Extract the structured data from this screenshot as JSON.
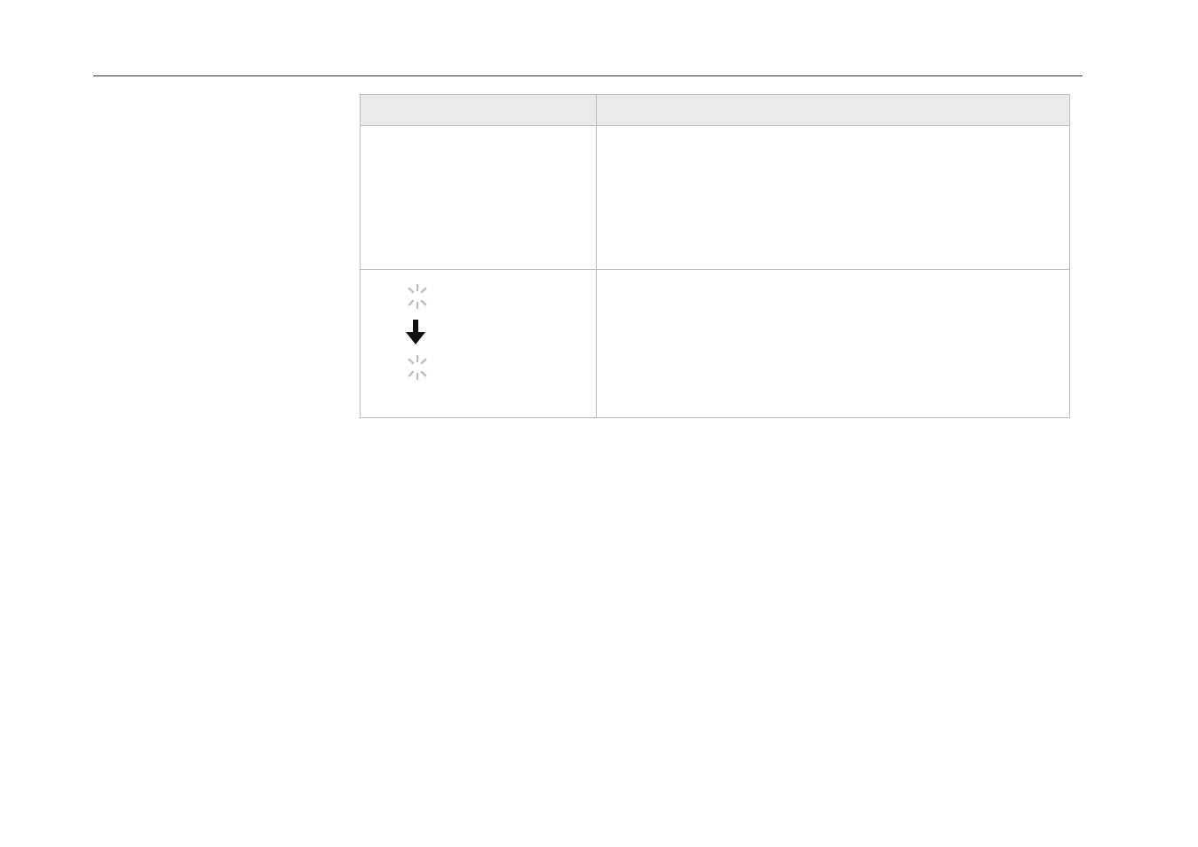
{
  "table": {
    "headers": [
      "",
      ""
    ],
    "rows": [
      {
        "col1": "",
        "col2": ""
      },
      {
        "col1": "",
        "col2": ""
      }
    ]
  },
  "icons": {
    "spinner_name": "loading-spinner-icon",
    "arrow_name": "down-arrow-icon"
  }
}
